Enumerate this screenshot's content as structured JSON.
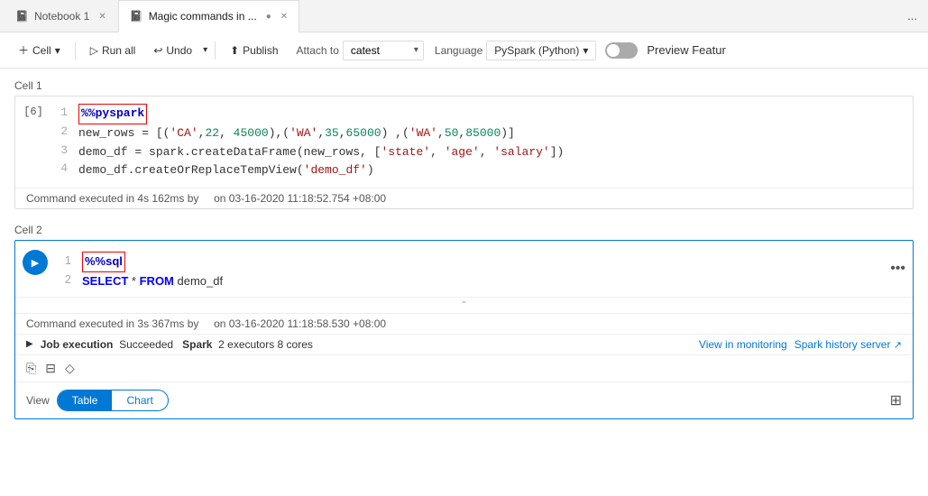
{
  "tabs": [
    {
      "id": "notebook1",
      "icon": "notebook-icon",
      "label": "Notebook 1",
      "active": false
    },
    {
      "id": "magic-commands",
      "icon": "notebook-icon",
      "label": "Magic commands in ...",
      "active": true
    }
  ],
  "tab_more": "...",
  "toolbar": {
    "cell_label": "Cell",
    "run_all_label": "Run all",
    "undo_label": "Undo",
    "publish_label": "Publish",
    "attach_label": "Attach to",
    "attach_value": "catest",
    "language_label": "Language",
    "language_value": "PySpark (Python)",
    "preview_label": "Preview Featur"
  },
  "cell1": {
    "label": "Cell 1",
    "exec_num": "[6]",
    "lines": [
      {
        "num": "1",
        "content": "%%pyspark",
        "type": "magic"
      },
      {
        "num": "2",
        "content": "new_rows = [('CA',22, 45000),('WA',35,65000) ,('WA',50,85000)]",
        "type": "code"
      },
      {
        "num": "3",
        "content": "demo_df = spark.createDataFrame(new_rows, ['state', 'age', 'salary'])",
        "type": "code"
      },
      {
        "num": "4",
        "content": "demo_df.createOrReplaceTempView('demo_df')",
        "type": "code"
      }
    ],
    "status": "Command executed in 4s 162ms by",
    "status_mid": "on 03-16-2020 11:18:52.754 +08:00"
  },
  "cell2": {
    "label": "Cell 2",
    "lines": [
      {
        "num": "1",
        "content": "%%sql",
        "type": "magic"
      },
      {
        "num": "2",
        "content": "SELECT * FROM demo_df",
        "type": "sql"
      }
    ],
    "status": "Command executed in 3s 367ms by",
    "status_mid": "on 03-16-2020 11:18:58.530 +08:00",
    "job_play": "▶",
    "job_label": "Job execution",
    "job_status": "Succeeded",
    "job_spark": "Spark",
    "job_executors": "2 executors 8 cores",
    "view_monitoring": "View in monitoring",
    "spark_history": "Spark history server",
    "view_label": "View",
    "view_table": "Table",
    "view_chart": "Chart"
  }
}
